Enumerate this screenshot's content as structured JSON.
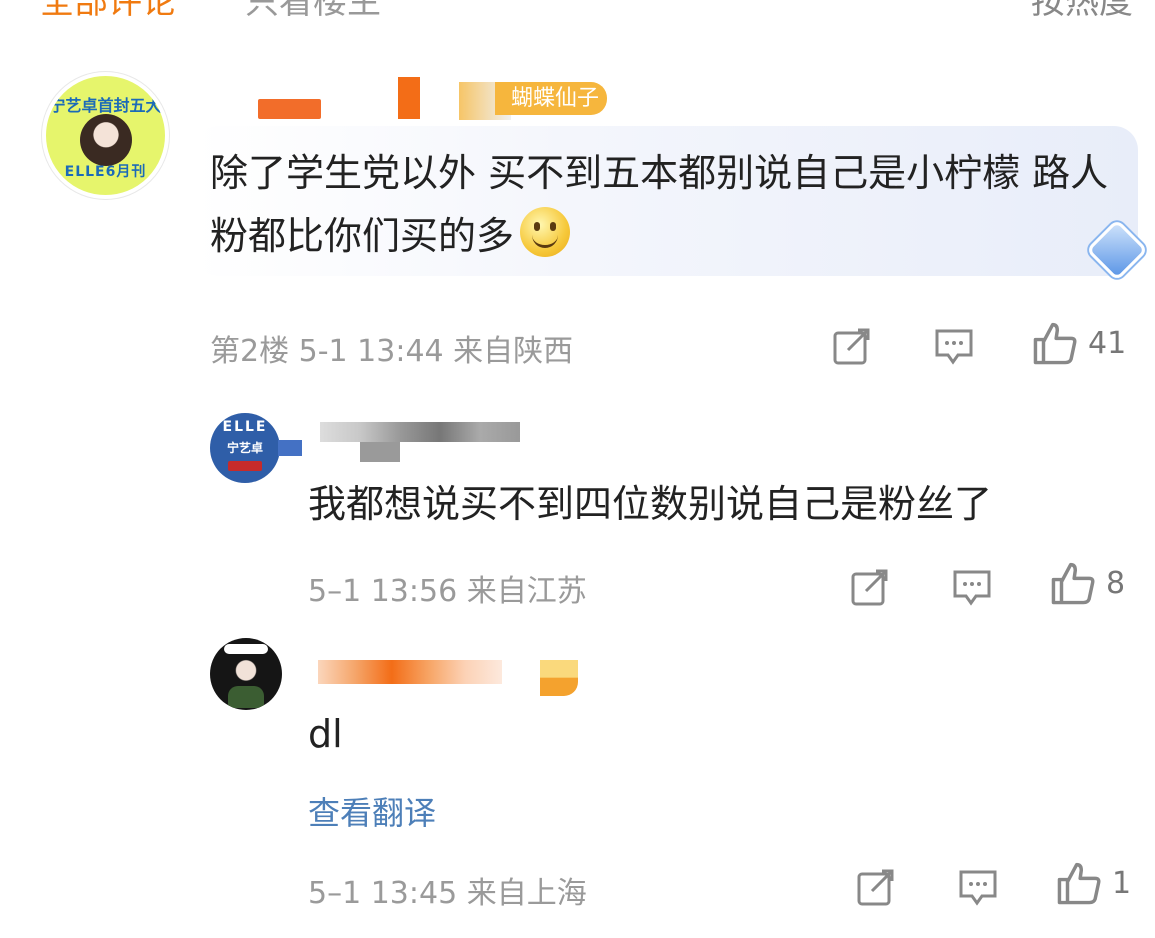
{
  "header": {
    "all_comments": "全部评论",
    "view_owner": "只看楼主",
    "sort": "按热度"
  },
  "comments": [
    {
      "badge": "蝴蝶仙子",
      "avatar_text_top": "宁艺卓首封五大",
      "avatar_text_bottom": "ELLE6月刊",
      "text": "除了学生党以外 买不到五本都别说自己是小柠檬 路人粉都比你们买的多",
      "meta": "第2楼 5-1 13:44 来自陕西",
      "likes": "41"
    },
    {
      "avatar_text_top": "ELLE",
      "avatar_text_bottom": "宁艺卓",
      "text": "我都想说买不到四位数别说自己是粉丝了",
      "meta": "5–1 13:56 来自江苏",
      "likes": "8"
    },
    {
      "text": "dl",
      "translate": "查看翻译",
      "meta": "5–1 13:45 来自上海",
      "likes": "1"
    }
  ],
  "icons": {
    "share": "share-icon",
    "comment": "comment-icon",
    "like": "thumbs-up-icon"
  },
  "colors": {
    "accent": "#f07a10",
    "link": "#4d7fb8",
    "meta": "#9a9a9a"
  }
}
